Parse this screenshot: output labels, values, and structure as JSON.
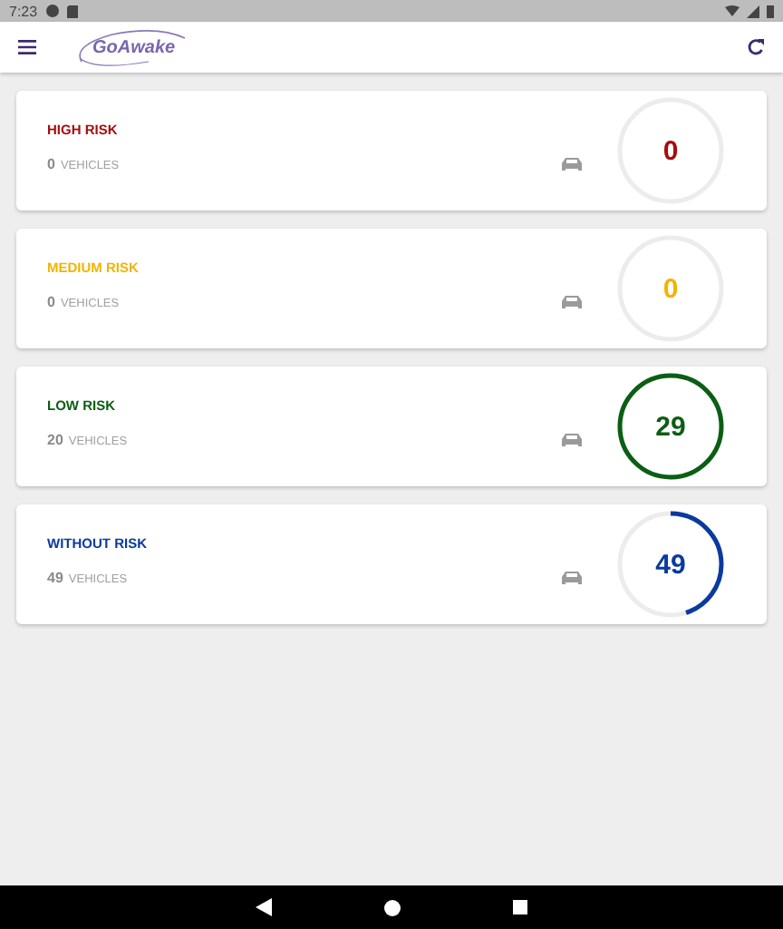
{
  "status_bar": {
    "time": "7:23"
  },
  "app_bar": {
    "logo": "GoAwake"
  },
  "cards": [
    {
      "title": "HIGH RISK",
      "count": "0",
      "unit": "VEHICLES",
      "value": "0",
      "kind": "empty",
      "color": "#a50e0e"
    },
    {
      "title": "MEDIUM RISK",
      "count": "0",
      "unit": "VEHICLES",
      "value": "0",
      "kind": "empty",
      "color": "#f2b400"
    },
    {
      "title": "LOW RISK",
      "count": "20",
      "unit": "VEHICLES",
      "value": "29",
      "kind": "full",
      "color": "#0b5e14"
    },
    {
      "title": "WITHOUT RISK",
      "count": "49",
      "unit": "VEHICLES",
      "value": "49",
      "kind": "partial",
      "color": "#0a3aa0"
    }
  ]
}
